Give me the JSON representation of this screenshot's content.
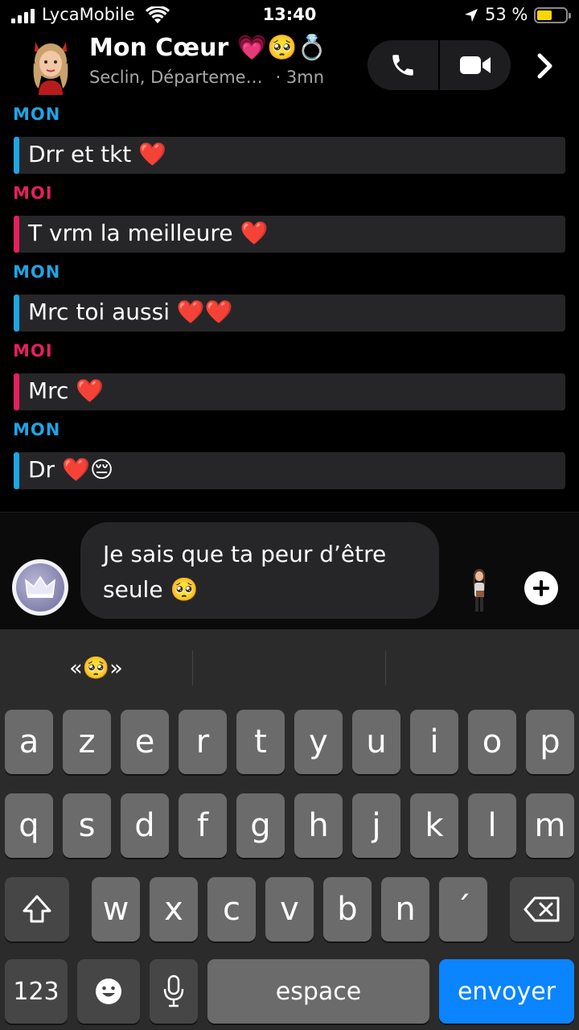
{
  "status_bar": {
    "carrier": "LycaMobile",
    "time": "13:40",
    "battery_percent": "53 %",
    "battery_level": 0.53
  },
  "header": {
    "contact_name": "Mon Cœur 💗🥺💍",
    "location": "Seclin, Départeme…",
    "last_seen": "· 3mn"
  },
  "messages": [
    {
      "sender": "MON",
      "role": "mon",
      "text": "Drr et tkt ❤️"
    },
    {
      "sender": "MOI",
      "role": "moi",
      "text": "T vrm la meilleure ❤️"
    },
    {
      "sender": "MON",
      "role": "mon",
      "text": "Mrc toi aussi ❤️❤️"
    },
    {
      "sender": "MOI",
      "role": "moi",
      "text": "Mrc ❤️"
    },
    {
      "sender": "MON",
      "role": "mon",
      "text": "Dr ❤️😔"
    }
  ],
  "composer": {
    "draft": "Je sais que ta peur d’être seule 🥺"
  },
  "keyboard": {
    "suggestions": [
      "«🥺»",
      "",
      ""
    ],
    "row1": [
      "a",
      "z",
      "e",
      "r",
      "t",
      "y",
      "u",
      "i",
      "o",
      "p"
    ],
    "row2": [
      "q",
      "s",
      "d",
      "f",
      "g",
      "h",
      "j",
      "k",
      "l",
      "m"
    ],
    "row3": [
      "w",
      "x",
      "c",
      "v",
      "b",
      "n",
      "´"
    ],
    "numbers_label": "123",
    "space_label": "espace",
    "send_label": "envoyer"
  },
  "icons": [
    "signal-icon",
    "wifi-icon",
    "location-arrow-icon",
    "battery-icon",
    "phone-icon",
    "video-camera-icon",
    "chevron-right-icon",
    "bitmoji-crown-icon",
    "bitmoji-figure-icon",
    "plus-icon",
    "shift-icon",
    "backspace-icon",
    "emoji-icon",
    "microphone-icon"
  ],
  "colors": {
    "mon": "#1ea5e4",
    "moi": "#e5205e",
    "send": "#0a84ff",
    "battery": "#ffd60a"
  }
}
